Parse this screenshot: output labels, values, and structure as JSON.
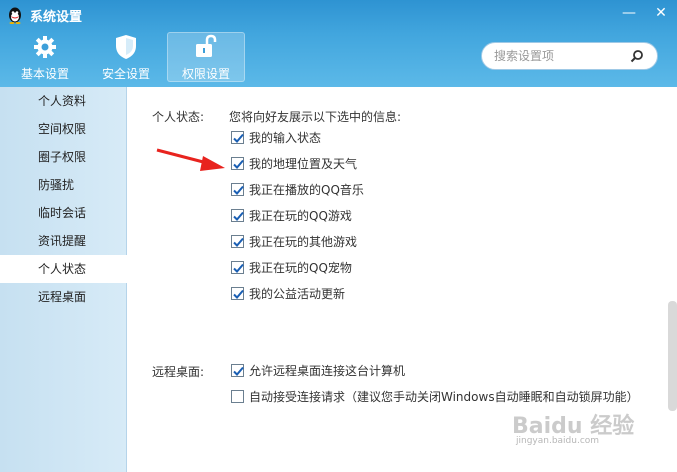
{
  "window": {
    "title": "系统设置",
    "minimize": "—",
    "close": "✕"
  },
  "nav": {
    "tabs": [
      {
        "label": "基本设置",
        "icon": "gear-icon"
      },
      {
        "label": "安全设置",
        "icon": "shield-icon"
      },
      {
        "label": "权限设置",
        "icon": "unlock-icon",
        "active": true
      }
    ]
  },
  "search": {
    "placeholder": "搜索设置项"
  },
  "sidebar": {
    "items": [
      {
        "label": "个人资料"
      },
      {
        "label": "空间权限"
      },
      {
        "label": "圈子权限"
      },
      {
        "label": "防骚扰"
      },
      {
        "label": "临时会话"
      },
      {
        "label": "资讯提醒"
      },
      {
        "label": "个人状态",
        "active": true
      },
      {
        "label": "远程桌面"
      }
    ]
  },
  "status_section": {
    "label": "个人状态:",
    "description": "您将向好友展示以下选中的信息:",
    "options": [
      {
        "label": "我的输入状态",
        "checked": true
      },
      {
        "label": "我的地理位置及天气",
        "checked": true
      },
      {
        "label": "我正在播放的QQ音乐",
        "checked": true
      },
      {
        "label": "我正在玩的QQ游戏",
        "checked": true
      },
      {
        "label": "我正在玩的其他游戏",
        "checked": true
      },
      {
        "label": "我正在玩的QQ宠物",
        "checked": true
      },
      {
        "label": "我的公益活动更新",
        "checked": true
      }
    ]
  },
  "remote_section": {
    "label": "远程桌面:",
    "options": [
      {
        "label": "允许远程桌面连接这台计算机",
        "checked": true
      },
      {
        "label": "自动接受连接请求（建议您手动关闭Windows自动睡眠和自动锁屏功能）",
        "checked": false
      }
    ]
  },
  "watermark": {
    "text": "Baidu 经验",
    "sub": "jingyan.baidu.com"
  },
  "colors": {
    "header": "#42a6de",
    "sidebar": "#c6e0f1",
    "arrow": "#e8231e",
    "check": "#1a5fb4"
  }
}
